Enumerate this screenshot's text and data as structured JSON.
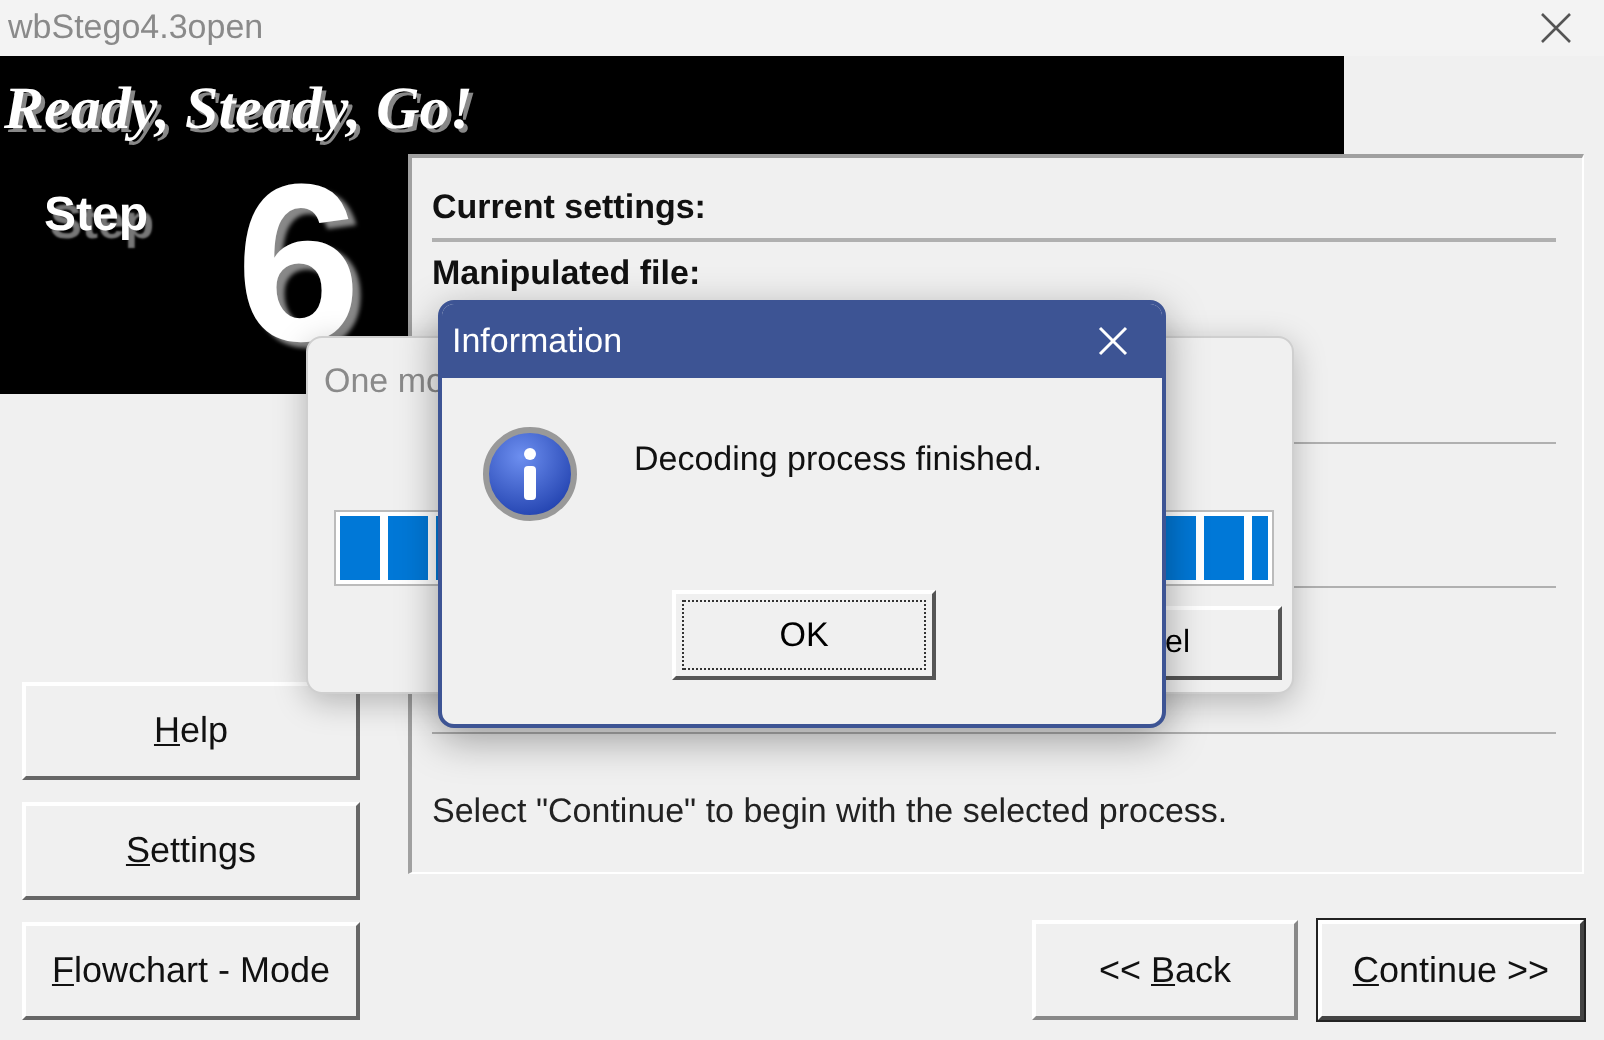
{
  "window": {
    "title": "wbStego4.3open"
  },
  "banner": {
    "heading": "Ready, Steady, Go!",
    "step_label": "Step",
    "step_number": "6"
  },
  "panel": {
    "current_settings": "Current settings:",
    "manipulated_file_label": "Manipulated file:",
    "instruction": "Select \"Continue\" to begin with the selected process."
  },
  "side_buttons": [
    {
      "accel": "H",
      "after": "elp"
    },
    {
      "accel": "S",
      "after": "ettings"
    },
    {
      "accel": "F",
      "after": "lowchart - Mode"
    }
  ],
  "nav_buttons": [
    {
      "before": "<< ",
      "accel": "B",
      "after": "ack",
      "default": false
    },
    {
      "accel": "C",
      "after": "ontinue >>",
      "default": true
    }
  ],
  "progress_dialog": {
    "title": "One mo",
    "level": 1,
    "cancel_button": "el"
  },
  "info_dialog": {
    "title": "Information",
    "message": "Decoding process finished.",
    "ok_button": "OK"
  }
}
